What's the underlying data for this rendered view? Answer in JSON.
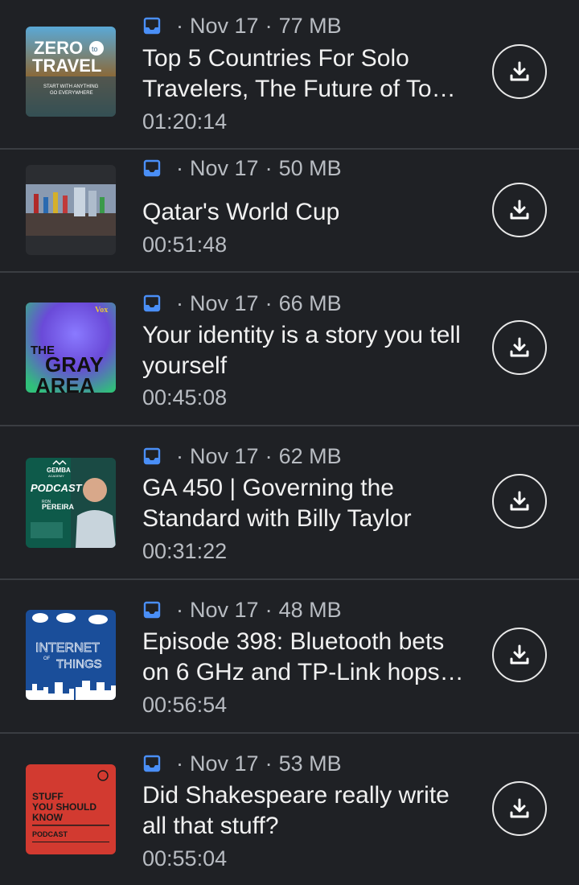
{
  "episodes": [
    {
      "date": "Nov 17",
      "size": "77 MB",
      "title": "Top 5 Countries For Solo Travelers, The Future of To…",
      "duration": "01:20:14",
      "art_name": "zero-to-travel-artwork",
      "art_text": {
        "line1": "ZERO",
        "to": "to",
        "line2": "TRAVEL",
        "tag1": "START WITH ANYTHING",
        "tag2": "GO EVERYWHERE"
      }
    },
    {
      "date": "Nov 17",
      "size": "50 MB",
      "title": "Qatar's World Cup",
      "duration": "00:51:48",
      "art_name": "qatar-world-cup-artwork"
    },
    {
      "date": "Nov 17",
      "size": "66 MB",
      "title": "Your identity is a story you tell yourself",
      "duration": "00:45:08",
      "art_name": "the-gray-area-artwork",
      "art_text": {
        "brand": "Vox",
        "w1": "THE",
        "w2": "GRAY",
        "w3": "AREA"
      }
    },
    {
      "date": "Nov 17",
      "size": "62 MB",
      "title": "GA 450 | Governing the Standard with Billy Taylor",
      "duration": "00:31:22",
      "art_name": "gemba-academy-podcast-artwork",
      "art_text": {
        "brand": "GEMBA",
        "brand2": "ACADEMY",
        "label": "PODCAST",
        "host1": "RON",
        "host2": "PEREIRA"
      }
    },
    {
      "date": "Nov 17",
      "size": "48 MB",
      "title": "Episode 398: Bluetooth bets on 6 GHz and TP-Link hops…",
      "duration": "00:56:54",
      "art_name": "internet-of-things-artwork",
      "art_text": {
        "w1": "INTERNET",
        "w2": "OF",
        "w3": "THINGS"
      }
    },
    {
      "date": "Nov 17",
      "size": "53 MB",
      "title": "Did Shakespeare really write all that stuff?",
      "duration": "00:55:04",
      "art_name": "stuff-you-should-know-artwork",
      "art_text": {
        "l1": "STUFF",
        "l2": "YOU SHOULD",
        "l3": "KNOW",
        "l4": "PODCAST"
      }
    }
  ],
  "colors": {
    "background": "#1f2125",
    "divider": "#3a3d42",
    "source_icon": "#4a8ff7",
    "text_primary": "#f1f1f1",
    "text_secondary": "#b8bcc2"
  },
  "icons": {
    "source": "inbox-tray-icon",
    "download": "download-icon"
  }
}
